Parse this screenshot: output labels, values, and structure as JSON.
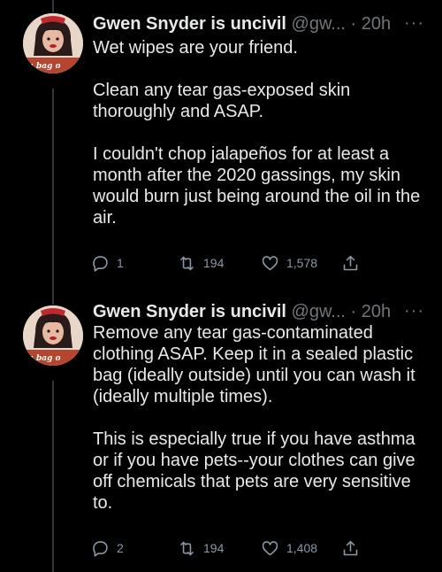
{
  "tweets": [
    {
      "author_name": "Gwen Snyder is uncivil",
      "handle": "@gw...",
      "separator": "·",
      "time": "20h",
      "more": "···",
      "avatar_text": "a bag o",
      "text": "Wet wipes are your friend.\n\nClean any tear gas-exposed skin thoroughly and ASAP.\n\nI couldn't chop jalapeños for at least a month after the 2020 gassings, my skin would burn just being around the oil in the air.",
      "replies": "1",
      "retweets": "194",
      "likes": "1,578"
    },
    {
      "author_name": "Gwen Snyder is uncivil",
      "handle": "@gw...",
      "separator": "·",
      "time": "20h",
      "more": "···",
      "avatar_text": "a bag o",
      "text": "Remove any tear gas-contaminated clothing ASAP. Keep it in a sealed plastic bag (ideally outside) until you can wash it (ideally multiple times).\n\nThis is especially true if you have asthma or if you have pets--your clothes can give off chemicals that pets are very sensitive to.",
      "replies": "2",
      "retweets": "194",
      "likes": "1,408"
    }
  ],
  "icons": [
    "reply-icon",
    "retweet-icon",
    "like-icon",
    "share-icon",
    "more-icon"
  ],
  "colors": {
    "background": "#000000",
    "text": "#e7e9ea",
    "secondary": "#71767b"
  }
}
